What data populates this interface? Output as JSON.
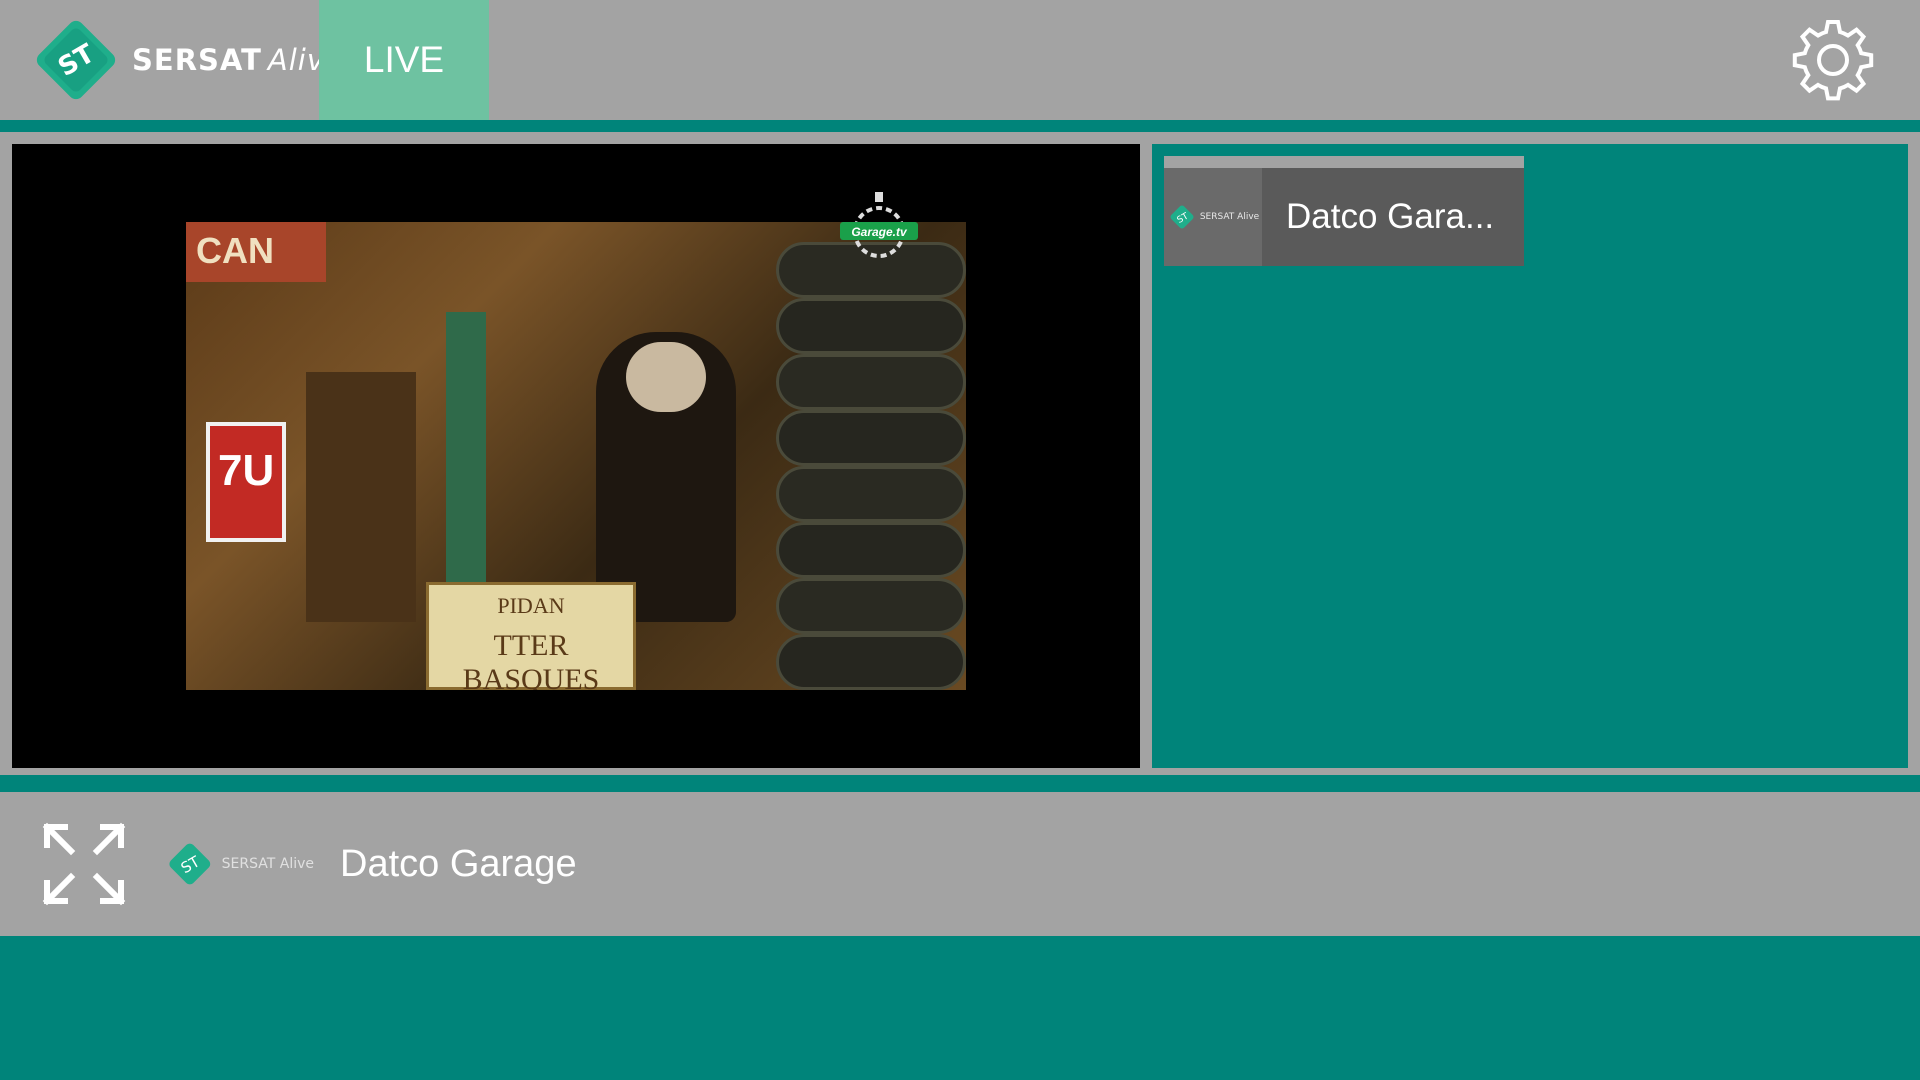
{
  "header": {
    "brand_bold": "SERSAT",
    "brand_italic": "Alive",
    "brand_mark": "ST",
    "live_tab_label": "LIVE",
    "settings_icon": "gear-icon"
  },
  "player": {
    "overlay_logo_text": "Garage.tv",
    "scene_sign_line1": "PIDAN",
    "scene_sign_line2": "TTER BASQUES",
    "scene_sign_left": "7U",
    "scene_sign_top": "CAN"
  },
  "channel_list": {
    "items": [
      {
        "name": "Datco Gara...",
        "logo_text": "SERSAT Alive"
      }
    ]
  },
  "now_playing": {
    "fullscreen_icon": "expand-icon",
    "logo_text": "SERSAT Alive",
    "channel_name": "Datco Garage"
  },
  "colors": {
    "teal": "#00847a",
    "gray": "#a3a3a3",
    "live_tab": "#6ec2a1",
    "card": "#5a5a5a"
  }
}
